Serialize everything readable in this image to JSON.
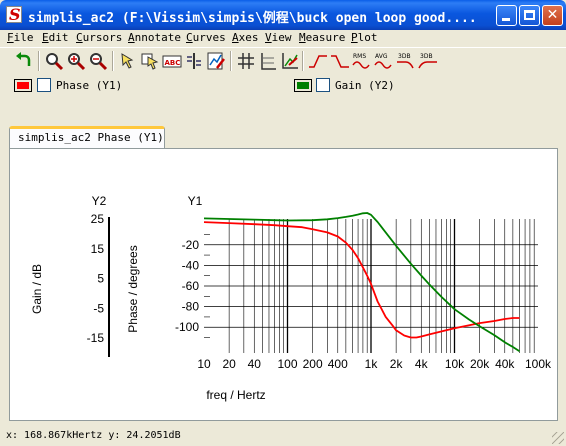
{
  "window": {
    "title": "simplis_ac2 (F:\\Vissim\\simpis\\例程\\buck open loop good...."
  },
  "menu": {
    "items": [
      "File",
      "Edit",
      "Cursors",
      "Annotate",
      "Curves",
      "Axes",
      "View",
      "Measure",
      "Plot"
    ]
  },
  "toolbar": {
    "icons": [
      "undo-icon",
      "zoom-icon",
      "zoom-in-icon",
      "zoom-out-icon",
      "cursor-icon",
      "cursor-move-icon",
      "annotate-abc-icon",
      "curve-marker-icon",
      "curve-edit-icon",
      "grid-icon",
      "grid-lines-icon",
      "axis-settings-icon",
      "rise-icon",
      "fall-icon",
      "rms-icon",
      "avg-icon",
      "3db-low-icon",
      "3db-high-icon"
    ],
    "rms_label": "RMS",
    "avg_label": "AVG",
    "db3_label": "3DB",
    "db3_label2": "3DB"
  },
  "legend": {
    "phase_label": "Phase  (Y1)",
    "gain_label": "Gain  (Y2)",
    "phase_color": "#ff0000",
    "gain_color": "#008000"
  },
  "tab": {
    "label": "simplis_ac2 Phase  (Y1)"
  },
  "status": {
    "text": "x: 168.867kHertz y: 24.2051dB"
  },
  "chart_data": {
    "type": "line",
    "x_scale": "log",
    "xlim": [
      10,
      100000
    ],
    "x_tick_labels": [
      "10",
      "20",
      "40",
      "100",
      "200",
      "400",
      "1k",
      "2k",
      "4k",
      "10k",
      "20k",
      "40k",
      "100k"
    ],
    "xlabel": "freq / Hertz",
    "y1": {
      "axis_title": "Y1",
      "label": "Phase / degrees",
      "ylim": [
        -125,
        5
      ],
      "tick_labels": [
        "-20",
        "-40",
        "-60",
        "-80",
        "-100"
      ]
    },
    "y2": {
      "axis_title": "Y2",
      "label": "Gain / dB",
      "ylim": [
        -20,
        25
      ],
      "tick_labels": [
        "25",
        "15",
        "5",
        "-5",
        "-15"
      ]
    },
    "grid": true,
    "series": [
      {
        "name": "Phase",
        "axis": "y1",
        "color": "#ff0000",
        "x": [
          10,
          20,
          40,
          70,
          100,
          150,
          200,
          300,
          400,
          500,
          600,
          700,
          800,
          900,
          1000,
          1200,
          1500,
          1800,
          2000,
          2500,
          3000,
          3500,
          4000,
          5000,
          7000,
          10000,
          15000,
          20000,
          30000,
          40000,
          50000,
          60000
        ],
        "y": [
          2,
          1,
          0,
          -1,
          -2,
          -3,
          -5,
          -8,
          -12,
          -18,
          -25,
          -33,
          -42,
          -50,
          -58,
          -75,
          -90,
          -98,
          -103,
          -108,
          -110,
          -110,
          -109,
          -107,
          -104,
          -101,
          -98,
          -96,
          -94,
          -92,
          -91,
          -91
        ]
      },
      {
        "name": "Gain",
        "axis": "y2",
        "color": "#008000",
        "x": [
          10,
          20,
          40,
          70,
          100,
          200,
          300,
          400,
          500,
          600,
          700,
          800,
          900,
          1000,
          1200,
          1500,
          2000,
          3000,
          4000,
          5000,
          7000,
          10000,
          15000,
          20000,
          30000,
          40000,
          50000,
          60000
        ],
        "y": [
          25.2,
          25.0,
          24.8,
          24.6,
          24.5,
          24.6,
          24.9,
          25.3,
          25.7,
          26.1,
          26.5,
          26.9,
          27.0,
          26.4,
          24.0,
          20.5,
          16.0,
          10.0,
          6.0,
          3.0,
          -1.2,
          -5.3,
          -8.8,
          -11.0,
          -14.0,
          -16.4,
          -18.0,
          -19.4
        ]
      }
    ]
  }
}
